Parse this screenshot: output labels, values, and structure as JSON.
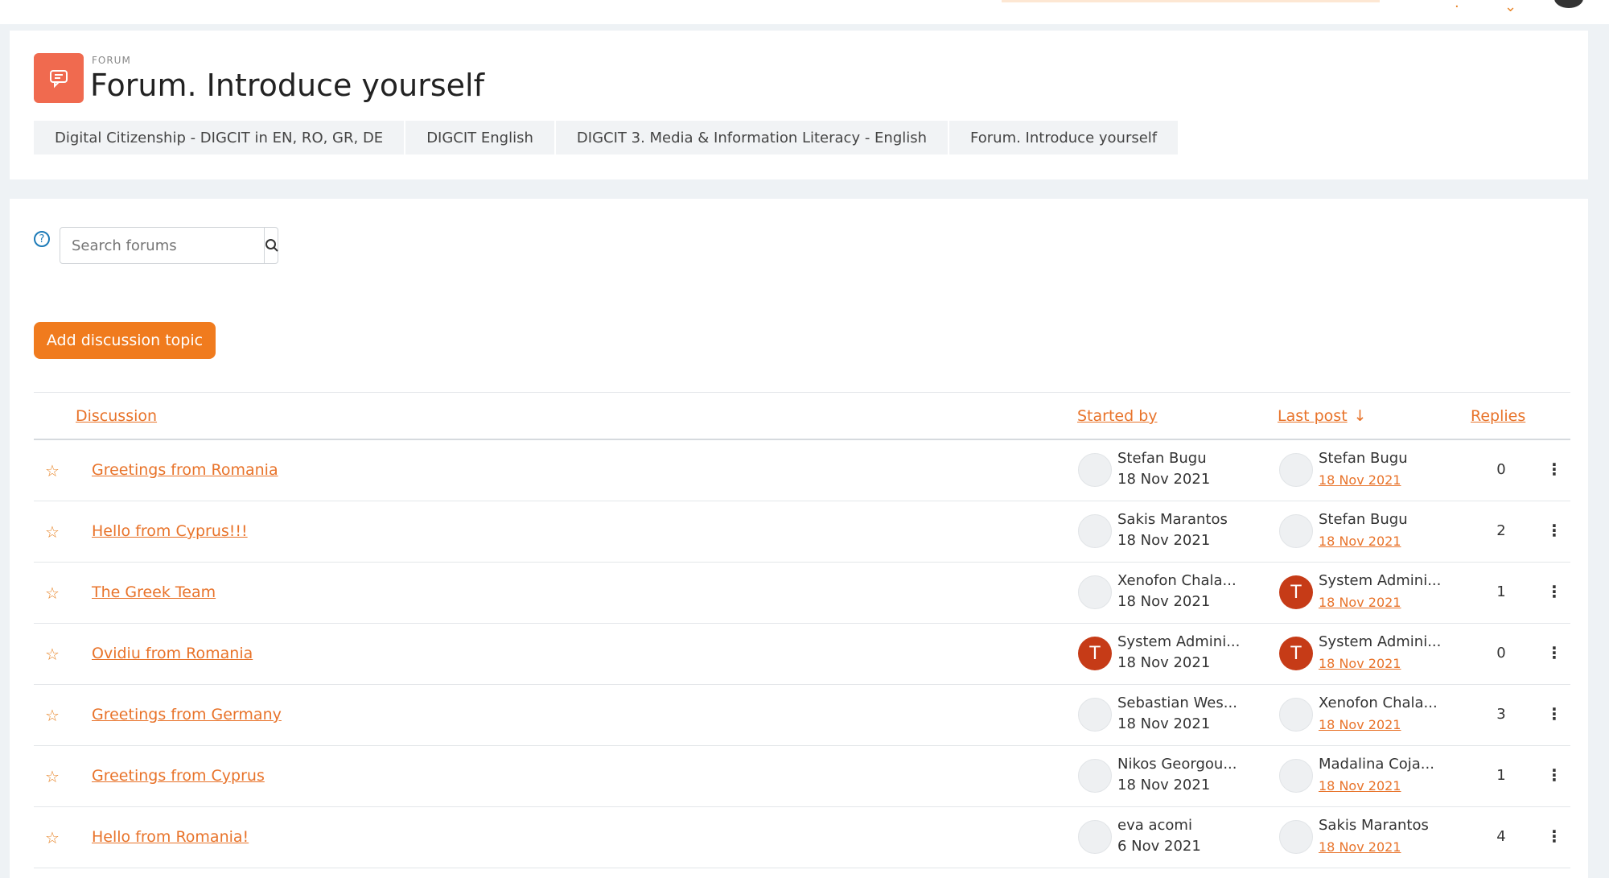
{
  "header": {
    "module_label": "FORUM",
    "title": "Forum. Introduce yourself",
    "breadcrumb": [
      "Digital Citizenship - DIGCIT in EN, RO, GR, DE",
      "DIGCIT English",
      "DIGCIT 3. Media & Information Literacy - English",
      "Forum. Introduce yourself"
    ]
  },
  "search": {
    "placeholder": "Search forums",
    "help_icon": "question-circle-icon",
    "button_icon": "search-icon"
  },
  "add_button_label": "Add discussion topic",
  "colors": {
    "accent": "#e8732a",
    "button": "#f07b1e",
    "forum_icon_bg": "#f06a4f",
    "avatar_initial_bg": "#c63b17"
  },
  "table": {
    "columns": {
      "discussion": "Discussion",
      "started_by": "Started by",
      "last_post": "Last post",
      "replies": "Replies"
    },
    "sort_indicator": "↓",
    "rows": [
      {
        "topic": "Greetings from Romania",
        "starter": "Stefan Bugu",
        "starter_avatar": "",
        "started": "18 Nov 2021",
        "last_by": "Stefan Bugu",
        "last_avatar": "",
        "last_date": "18 Nov 2021",
        "replies": "0"
      },
      {
        "topic": "Hello from Cyprus!!!",
        "starter": "Sakis Marantos",
        "starter_avatar": "",
        "started": "18 Nov 2021",
        "last_by": "Stefan Bugu",
        "last_avatar": "",
        "last_date": "18 Nov 2021",
        "replies": "2"
      },
      {
        "topic": "The Greek Team",
        "starter": "Xenofon Chala...",
        "starter_avatar": "",
        "started": "18 Nov 2021",
        "last_by": "System Admini...",
        "last_avatar": "T",
        "last_date": "18 Nov 2021",
        "replies": "1"
      },
      {
        "topic": "Ovidiu from Romania",
        "starter": "System Admini...",
        "starter_avatar": "T",
        "started": "18 Nov 2021",
        "last_by": "System Admini...",
        "last_avatar": "T",
        "last_date": "18 Nov 2021",
        "replies": "0"
      },
      {
        "topic": "Greetings from Germany",
        "starter": "Sebastian Wes...",
        "starter_avatar": "",
        "started": "18 Nov 2021",
        "last_by": "Xenofon Chala...",
        "last_avatar": "",
        "last_date": "18 Nov 2021",
        "replies": "3"
      },
      {
        "topic": "Greetings from Cyprus",
        "starter": "Nikos Georgou...",
        "starter_avatar": "",
        "started": "18 Nov 2021",
        "last_by": "Madalina Coja...",
        "last_avatar": "",
        "last_date": "18 Nov 2021",
        "replies": "1"
      },
      {
        "topic": "Hello from Romania!",
        "starter": "eva acomi",
        "starter_avatar": "",
        "started": "6 Nov 2021",
        "last_by": "Sakis Marantos",
        "last_avatar": "",
        "last_date": "18 Nov 2021",
        "replies": "4"
      }
    ]
  }
}
